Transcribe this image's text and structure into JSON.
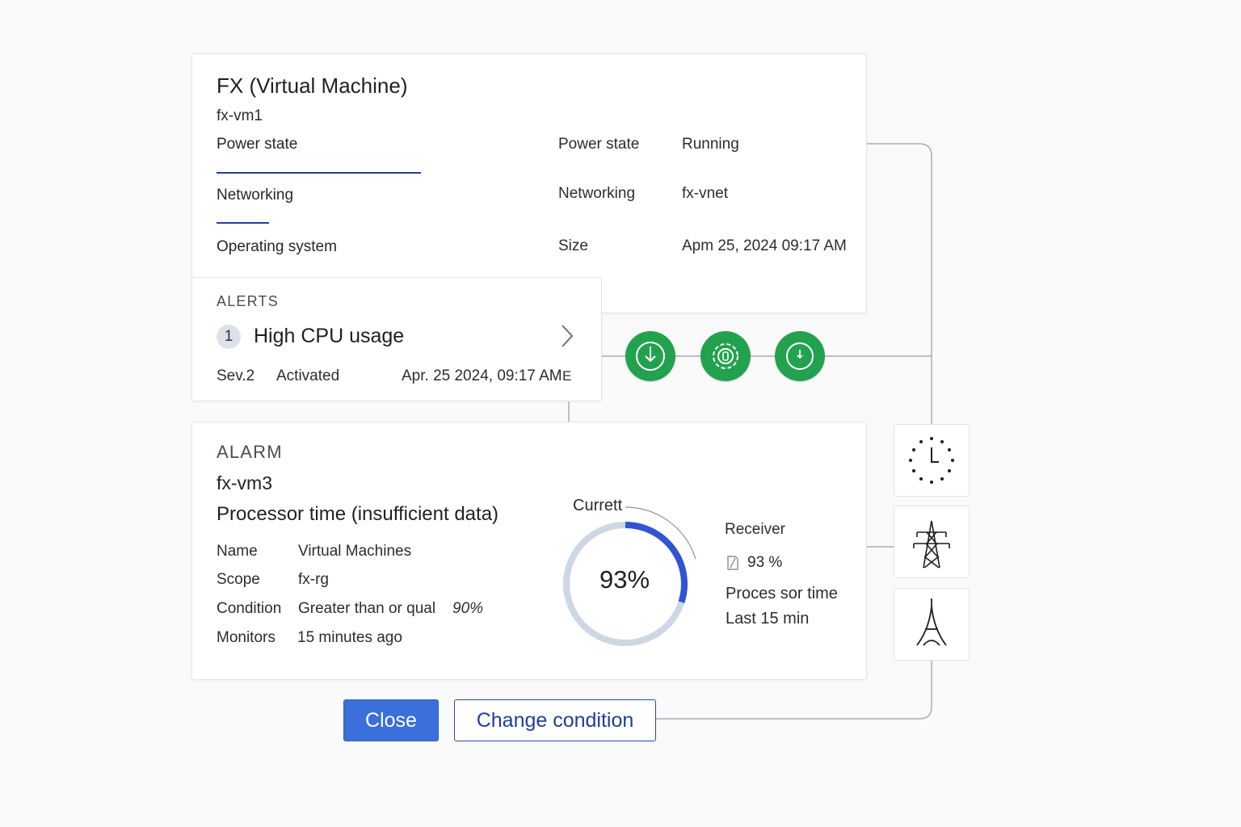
{
  "vm": {
    "title": "FX (Virtual Machine)",
    "name": "fx-vm1",
    "nav": [
      "Power state",
      "Networking",
      "Operating system"
    ],
    "props": [
      {
        "label": "Power state",
        "value": "Running"
      },
      {
        "label": "Networking",
        "value": "fx-vnet"
      },
      {
        "label": "Size",
        "value": "Apm 25, 2024 09:17 AM"
      }
    ]
  },
  "alerts": {
    "heading": "ALERTS",
    "count": "1",
    "title": "High CPU usage",
    "severity": "Sev.2",
    "status": "Activated",
    "timestamp": "Apr. 25 2024, 09:17 AM",
    "trailing_glyph": "E"
  },
  "steps": [
    "download-circle-icon",
    "settings-circle-icon",
    "clock-circle-icon"
  ],
  "side_tiles": [
    "clock-icon",
    "power-tower-icon",
    "eiffel-tower-icon"
  ],
  "alarm": {
    "heading": "ALARM",
    "vm": "fx-vm3",
    "subtitle": "Processor time (insufficient data)",
    "rows": [
      {
        "label": "Name",
        "value": "Virtual Machines"
      },
      {
        "label": "Scope",
        "value": "fx-rg"
      },
      {
        "label": "Condition",
        "value": "Greater than or qual",
        "extra": "90%"
      },
      {
        "label": "Monitors",
        "value": "15 minutes ago"
      }
    ],
    "gauge": {
      "label": "Currett",
      "value_text": "93%",
      "fill_fraction": 0.3
    },
    "receiver": {
      "title": "Receiver",
      "value": "93 %",
      "line1": "Proces sor time",
      "line2": "Last 15 min"
    }
  },
  "buttons": {
    "close": "Close",
    "change": "Change condition"
  },
  "colors": {
    "accent": "#3b6fd9",
    "step_green": "#22a24e",
    "nav_underline": "#1d3fa8",
    "gauge_fill": "#2f55d4",
    "gauge_track": "#cfd6e4"
  }
}
